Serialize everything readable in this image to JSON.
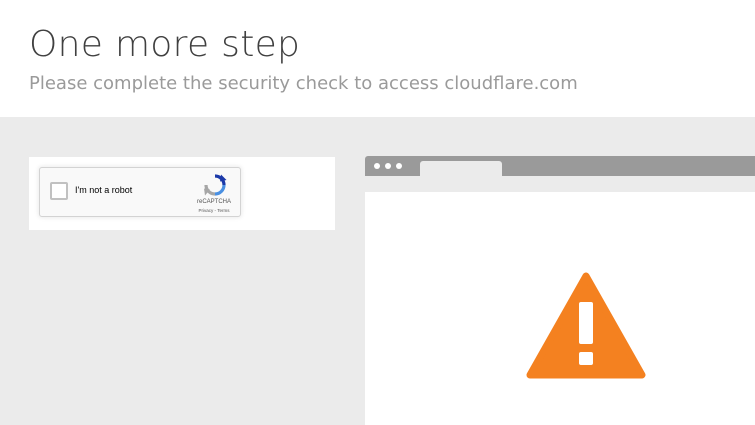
{
  "header": {
    "title": "One more step",
    "subtitle": "Please complete the security check to access cloudflare.com"
  },
  "captcha": {
    "checkbox_label": "I'm not a robot",
    "brand": "reCAPTCHA",
    "privacy_link": "Privacy",
    "separator": " - ",
    "terms_link": "Terms",
    "checked": false
  },
  "illustration": {
    "icon": "warning-triangle-icon",
    "colors": {
      "warning": "#f48120",
      "browser_chrome": "#9a9a9a",
      "recaptcha_blue": "#1c3aa9",
      "recaptcha_lightblue": "#4a90e2",
      "recaptcha_gray": "#a6a6a6"
    }
  }
}
